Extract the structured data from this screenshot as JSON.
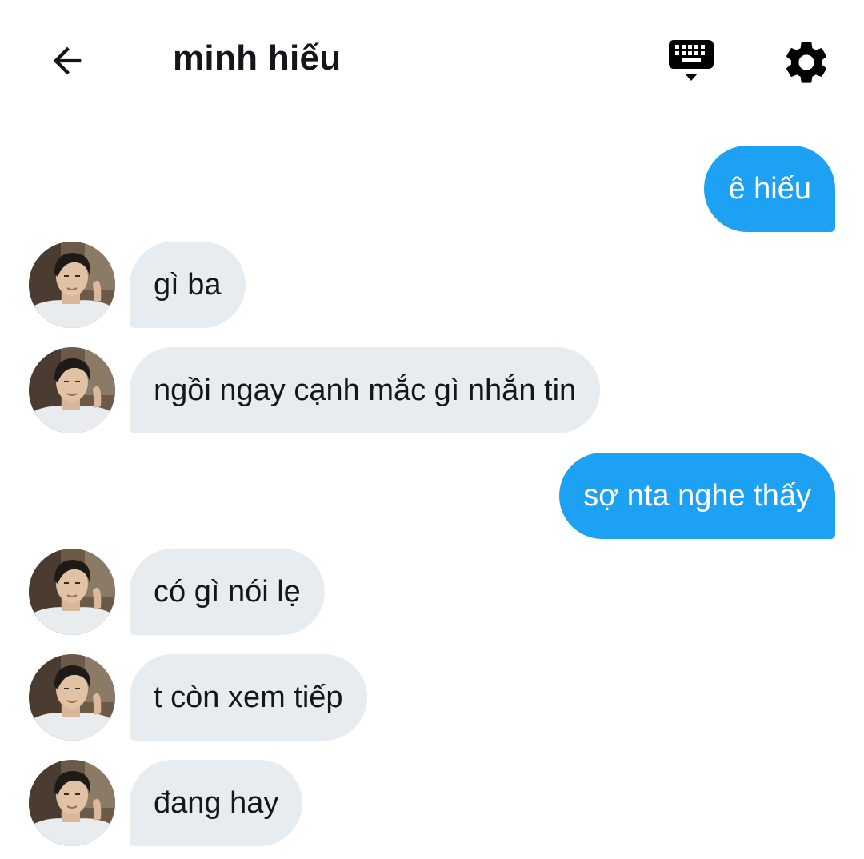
{
  "header": {
    "title": "minh hiếu",
    "back_icon": "arrow-left-icon",
    "keyboard_icon": "keyboard-hide-icon",
    "settings_icon": "gear-icon"
  },
  "colors": {
    "outgoing_bubble": "#1da1f2",
    "incoming_bubble": "#e6ecf0",
    "text": "#14171a"
  },
  "messages": [
    {
      "direction": "outgoing",
      "text": "ê hiếu"
    },
    {
      "direction": "incoming",
      "text": "gì ba"
    },
    {
      "direction": "incoming",
      "text": "ngồi ngay cạnh mắc gì nhắn tin"
    },
    {
      "direction": "outgoing",
      "text": "sợ nta nghe thấy"
    },
    {
      "direction": "incoming",
      "text": "có gì nói lẹ"
    },
    {
      "direction": "incoming",
      "text": "t còn xem tiếp"
    },
    {
      "direction": "incoming",
      "text": "đang hay"
    }
  ]
}
